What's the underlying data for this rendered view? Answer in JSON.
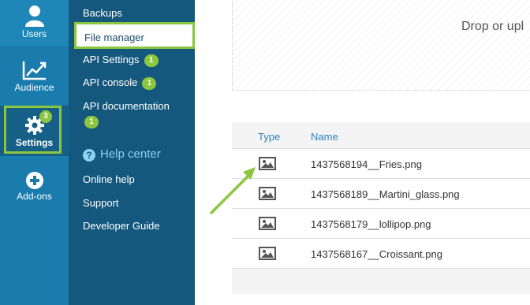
{
  "rail": {
    "users_label": "Users",
    "audience_label": "Audience",
    "settings_label": "Settings",
    "settings_badge": "3",
    "addons_label": "Add-ons"
  },
  "menu": {
    "backups": "Backups",
    "file_manager": "File manager",
    "api_settings": "API Settings",
    "api_settings_badge": "1",
    "api_console": "API console",
    "api_console_badge": "1",
    "api_documentation": "API documentation",
    "api_documentation_badge": "1",
    "help_center": "Help center",
    "online_help": "Online help",
    "support": "Support",
    "developer_guide": "Developer Guide"
  },
  "dropzone": {
    "text": "Drop or upl"
  },
  "table": {
    "headers": {
      "type": "Type",
      "name": "Name"
    },
    "rows": [
      {
        "name": "1437568194__Fries.png",
        "type_icon": "image-icon"
      },
      {
        "name": "1437568189__Martini_glass.png",
        "type_icon": "image-icon"
      },
      {
        "name": "1437568179__lollipop.png",
        "type_icon": "image-icon"
      },
      {
        "name": "1437568167__Croissant.png",
        "type_icon": "image-icon"
      }
    ]
  },
  "colors": {
    "rail_bg": "#1a7cad",
    "menu_bg": "#15587d",
    "accent_green": "#8cc63f",
    "link_blue": "#2a82c4"
  }
}
